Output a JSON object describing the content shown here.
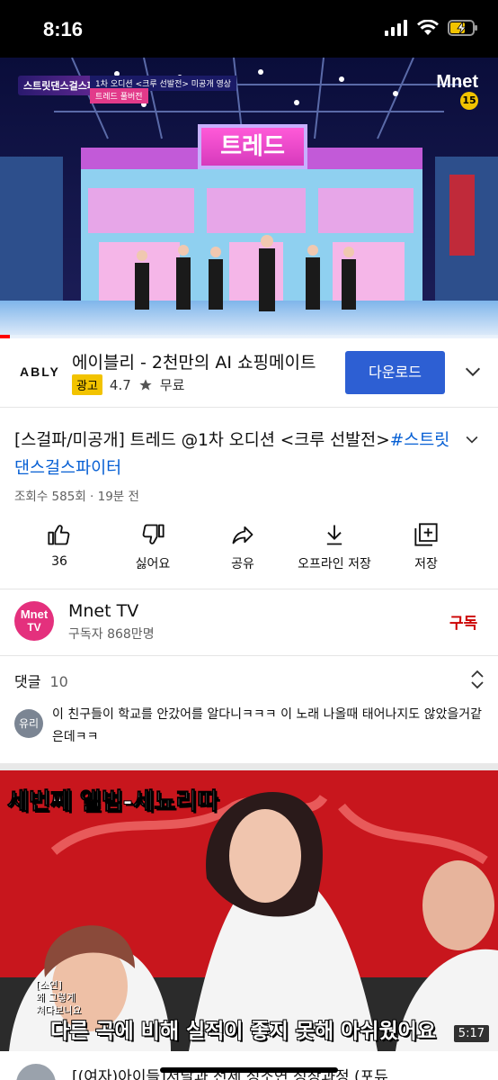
{
  "status_bar": {
    "time": "8:16"
  },
  "player": {
    "show_logo": "스트릿댄스걸스파이터",
    "episode_tag": "1차 오디션 <크루 선발전> 미공개 영상",
    "episode_tag2": "트레드 풀버전",
    "broadcaster": "Mnet",
    "age_rating": "15",
    "stage_sign": "트레드",
    "progress": 0.02,
    "accent_color": "#ff0000"
  },
  "ad": {
    "brand": "ABLY",
    "title": "에이블리 - 2천만의 AI 쇼핑메이트",
    "badge": "광고",
    "rating": "4.7",
    "price": "무료",
    "cta": "다운로드",
    "cta_color": "#2d5fd3"
  },
  "video": {
    "title": "[스걸파/미공개] 트레드 @1차 오디션 <크루 선발전>",
    "hashtag": "#스트릿댄스걸스파이터",
    "meta": "조회수 585회 · 19분 전"
  },
  "actions": {
    "like": "36",
    "dislike": "싫어요",
    "share": "공유",
    "offline": "오프라인 저장",
    "save": "저장"
  },
  "channel": {
    "avatar_top": "Mnet",
    "avatar_bottom": "TV",
    "name": "Mnet TV",
    "subscribers": "구독자 868만명",
    "subscribe_label": "구독",
    "brand_color": "#e4307d"
  },
  "comments": {
    "header": "댓글",
    "count": "10",
    "first": {
      "avatar_text": "유리",
      "text": "이 친구들이 학교를 안갔어를 알다니ㅋㅋㅋ 이 노래 나올때 태어나지도 않았을거같은데ㅋㅋ"
    }
  },
  "next_video": {
    "thumb_top_text": "세번째 앨범-세뇨리따",
    "thumb_name": "[소연]\n왜 그렇게\n쳐다보니요",
    "thumb_bottom_text": "다른 곡에 비해 실적이 좋지 못해 아쉬웠어요",
    "duration": "5:17",
    "title": "[(여자)아이들]서날과 전세 성소연 성장과정 (포듀"
  }
}
